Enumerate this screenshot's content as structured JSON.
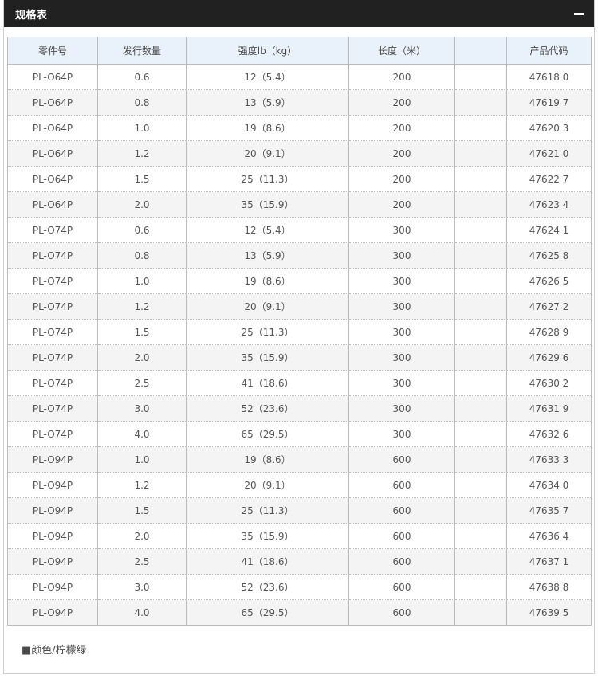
{
  "panel": {
    "title": "规格表"
  },
  "table": {
    "headers": [
      "零件号",
      "发行数量",
      "强度lb（kg）",
      "长度（米）",
      "",
      "产品代码"
    ],
    "rows": [
      [
        "PL-O64P",
        "0.6",
        "12（5.4）",
        "200",
        "",
        "47618 0"
      ],
      [
        "PL-O64P",
        "0.8",
        "13（5.9）",
        "200",
        "",
        "47619 7"
      ],
      [
        "PL-O64P",
        "1.0",
        "19（8.6）",
        "200",
        "",
        "47620 3"
      ],
      [
        "PL-O64P",
        "1.2",
        "20（9.1）",
        "200",
        "",
        "47621 0"
      ],
      [
        "PL-O64P",
        "1.5",
        "25（11.3）",
        "200",
        "",
        "47622 7"
      ],
      [
        "PL-O64P",
        "2.0",
        "35（15.9）",
        "200",
        "",
        "47623 4"
      ],
      [
        "PL-O74P",
        "0.6",
        "12（5.4）",
        "300",
        "",
        "47624 1"
      ],
      [
        "PL-O74P",
        "0.8",
        "13（5.9）",
        "300",
        "",
        "47625 8"
      ],
      [
        "PL-O74P",
        "1.0",
        "19（8.6）",
        "300",
        "",
        "47626 5"
      ],
      [
        "PL-O74P",
        "1.2",
        "20（9.1）",
        "300",
        "",
        "47627 2"
      ],
      [
        "PL-O74P",
        "1.5",
        "25（11.3）",
        "300",
        "",
        "47628 9"
      ],
      [
        "PL-O74P",
        "2.0",
        "35（15.9）",
        "300",
        "",
        "47629 6"
      ],
      [
        "PL-O74P",
        "2.5",
        "41（18.6）",
        "300",
        "",
        "47630 2"
      ],
      [
        "PL-O74P",
        "3.0",
        "52（23.6）",
        "300",
        "",
        "47631 9"
      ],
      [
        "PL-O74P",
        "4.0",
        "65（29.5）",
        "300",
        "",
        "47632 6"
      ],
      [
        "PL-O94P",
        "1.0",
        "19（8.6）",
        "600",
        "",
        "47633 3"
      ],
      [
        "PL-O94P",
        "1.2",
        "20（9.1）",
        "600",
        "",
        "47634 0"
      ],
      [
        "PL-O94P",
        "1.5",
        "25（11.3）",
        "600",
        "",
        "47635 7"
      ],
      [
        "PL-O94P",
        "2.0",
        "35（15.9）",
        "600",
        "",
        "47636 4"
      ],
      [
        "PL-O94P",
        "2.5",
        "41（18.6）",
        "600",
        "",
        "47637 1"
      ],
      [
        "PL-O94P",
        "3.0",
        "52（23.6）",
        "600",
        "",
        "47638 8"
      ],
      [
        "PL-O94P",
        "4.0",
        "65（29.5）",
        "600",
        "",
        "47639 5"
      ]
    ]
  },
  "note": "■颜色/柠檬绿",
  "colors": {
    "header_bg": "#212121",
    "table_header_bg": "#e9f1fb",
    "row_alt_bg": "#f4f4f4"
  }
}
